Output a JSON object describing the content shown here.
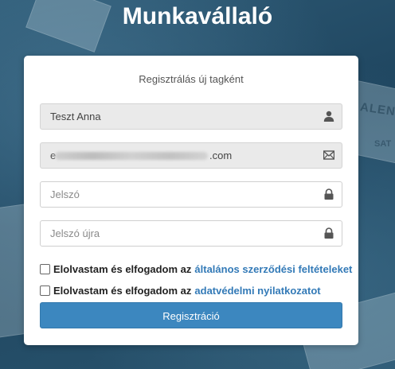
{
  "app": {
    "title": "Munkavállaló"
  },
  "form": {
    "title": "Regisztrálás új tagként",
    "name_value": "Teszt Anna",
    "email_lead": "e",
    "email_suffix": ".com",
    "password_placeholder": "Jelszó",
    "password_again_placeholder": "Jelszó újra",
    "terms_text": "Elolvastam és elfogadom az",
    "terms_link": "általános szerződési feltételeket",
    "privacy_text": "Elolvastam és elfogadom az",
    "privacy_link": "adatvédelmi nyilatkozatot",
    "submit_label": "Regisztráció"
  },
  "background": {
    "calendar_word": "ALEND",
    "day_word": "SAT"
  },
  "icons": {
    "name_field": "user-icon",
    "email_field": "envelope-icon",
    "password_field": "lock-icon",
    "password_again_field": "lock-icon"
  },
  "colors": {
    "accent": "#3c87bf",
    "link": "#337ab7",
    "background": "#234a63"
  }
}
